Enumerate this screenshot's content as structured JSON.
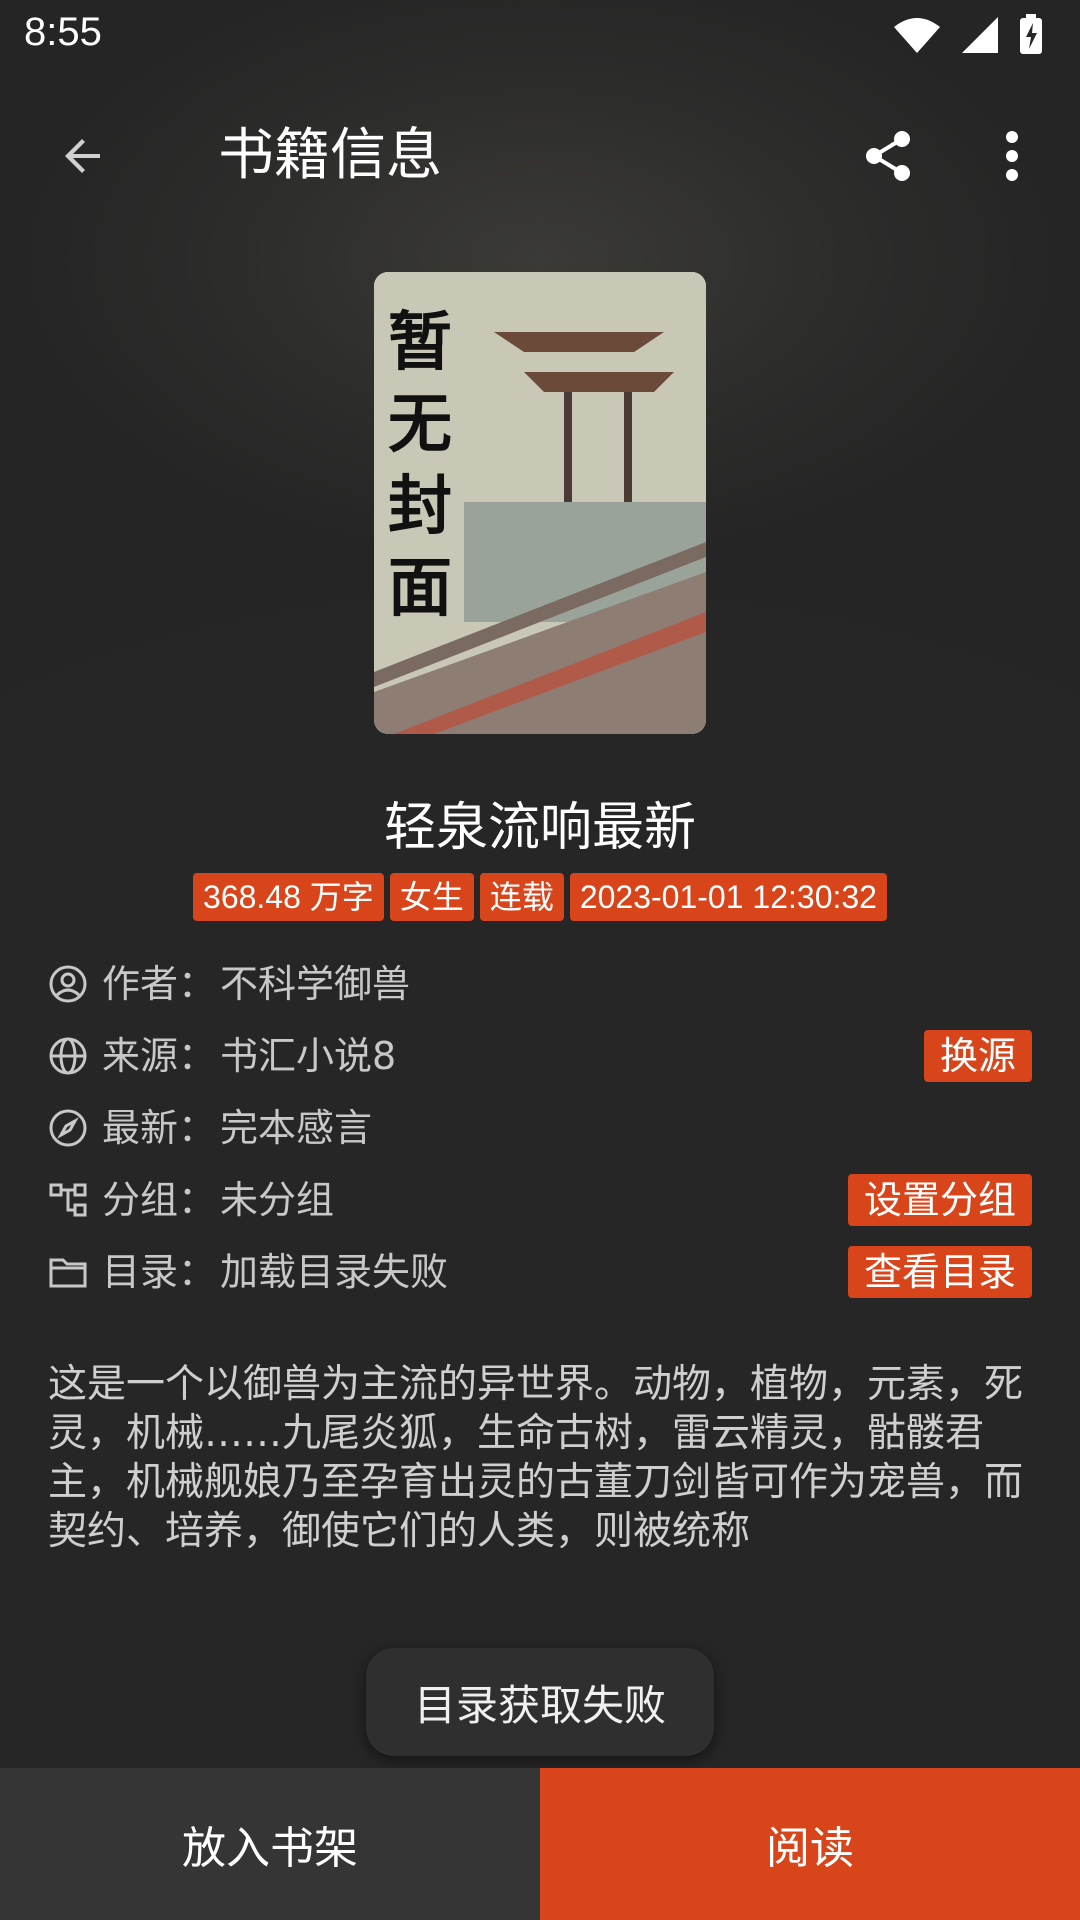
{
  "status_bar": {
    "time": "8:55",
    "icons": [
      "wifi-icon",
      "signal-icon",
      "battery-charging-icon"
    ]
  },
  "toolbar": {
    "title": "书籍信息",
    "back_icon": "arrow-left-icon",
    "share_icon": "share-icon",
    "more_icon": "more-vertical-icon"
  },
  "cover": {
    "text": "暂无封面"
  },
  "book": {
    "title": "轻泉流响最新",
    "tags": [
      "368.48 万字",
      "女生",
      "连载",
      "2023-01-01 12:30:32"
    ]
  },
  "info": {
    "author": {
      "label": "作者：",
      "value": "不科学御兽",
      "icon": "user-icon"
    },
    "source": {
      "label": "来源：",
      "value": "书汇小说8",
      "icon": "globe-icon",
      "button": "换源"
    },
    "latest": {
      "label": "最新：",
      "value": "完本感言",
      "icon": "compass-icon"
    },
    "group": {
      "label": "分组：",
      "value": "未分组",
      "icon": "group-icon",
      "button": "设置分组"
    },
    "toc": {
      "label": "目录：",
      "value": "加载目录失败",
      "icon": "folder-icon",
      "button": "查看目录"
    }
  },
  "description": "这是一个以御兽为主流的异世界。动物，植物，元素，死灵，机械……九尾炎狐，生命古树，雷云精灵，骷髅君主，机械舰娘乃至孕育出灵的古董刀剑皆可作为宠兽，而契约、培养，御使它们的人类，则被统称",
  "toast": "目录获取失败",
  "bottom": {
    "shelf_label": "放入书架",
    "read_label": "阅读"
  },
  "colors": {
    "accent": "#d9451a",
    "background": "#262626"
  }
}
